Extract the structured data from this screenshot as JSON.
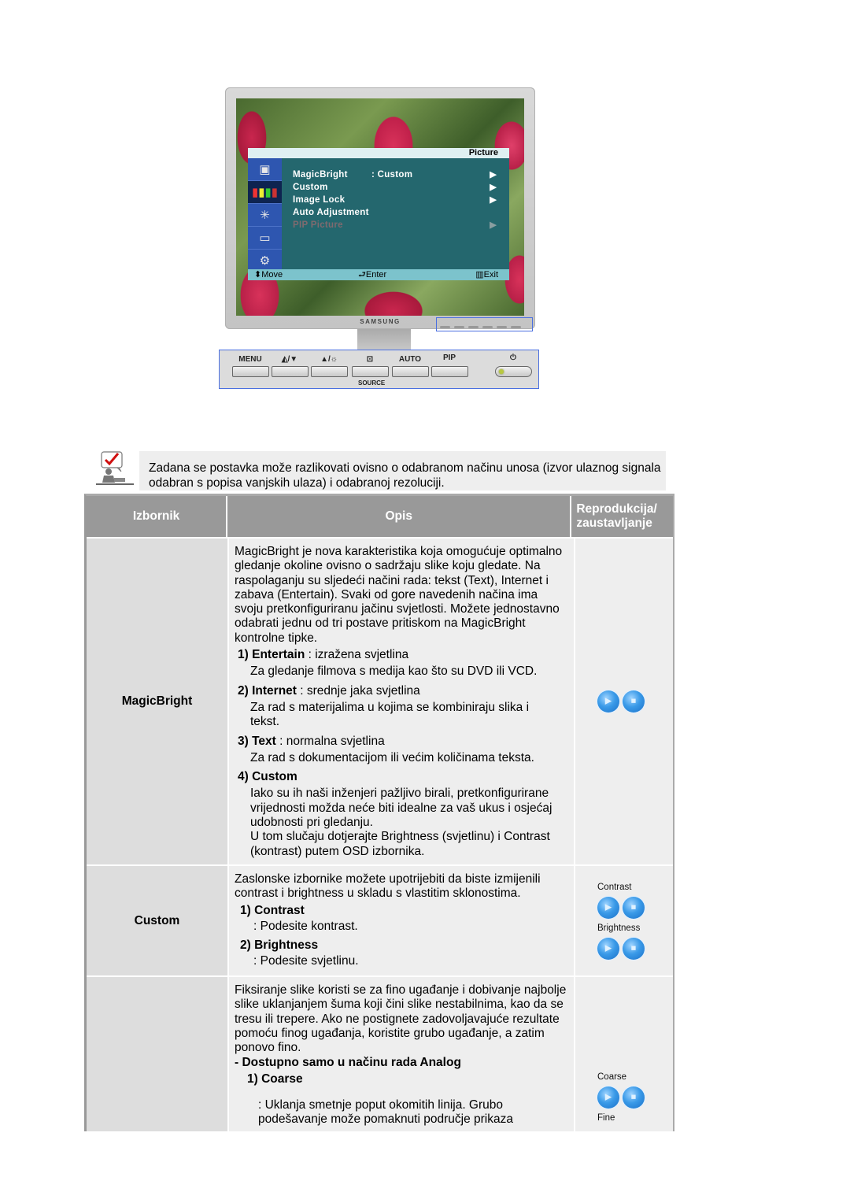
{
  "monitor": {
    "osd": {
      "title": "Picture",
      "side_icons": [
        "input-icon",
        "color-bars-icon",
        "magic-wand-icon",
        "pip-icon",
        "setup-sliders-icon"
      ],
      "items": [
        {
          "label": "MagicBright",
          "value": ": Custom",
          "arrow": "▶",
          "enabled": true
        },
        {
          "label": "Custom",
          "value": "",
          "arrow": "▶",
          "enabled": true
        },
        {
          "label": "Image Lock",
          "value": "",
          "arrow": "▶",
          "enabled": true
        },
        {
          "label": "Auto Adjustment",
          "value": "",
          "arrow": "",
          "enabled": true
        },
        {
          "label": "PIP Picture",
          "value": "",
          "arrow": "▶",
          "enabled": false
        }
      ],
      "footer": {
        "move": "⬍Move",
        "enter": "⮐Enter",
        "exit": "▥Exit"
      }
    },
    "brand": "SAMSUNG"
  },
  "control_panel": {
    "buttons": [
      {
        "label": "MENU",
        "icon": "menu-icon"
      },
      {
        "label": "◭/▼",
        "icon": "magicbright-down-icon"
      },
      {
        "label": "▲/☼",
        "icon": "up-brightness-icon"
      },
      {
        "label": "⊡",
        "icon": "source-icon"
      },
      {
        "label": "AUTO",
        "icon": ""
      },
      {
        "label": "PIP",
        "icon": ""
      }
    ],
    "source_label": "SOURCE",
    "power_glyph": "⏻"
  },
  "note": {
    "text": "Zadana se postavka može razlikovati ovisno o odabranom načinu unosa (izvor ulaznog signala odabran s popisa vanjskih ulaza) i odabranoj rezoluciji."
  },
  "table": {
    "headers": [
      "Izbornik",
      "Opis",
      "Reprodukcija/ zaustavljanje"
    ],
    "rows": [
      {
        "menu": "MagicBright",
        "intro": "MagicBright je nova karakteristika koja omogućuje optimalno gledanje okoline ovisno o sadržaju slike koju gledate. Na raspolaganju su sljedeći načini rada: tekst (Text), Internet i zabava (Entertain). Svaki od gore navedenih načina ima svoju pretkonfiguriranu jačinu svjetlosti. Možete jednostavno odabrati jednu od tri postave pritiskom na MagicBright kontrolne tipke.",
        "items": [
          {
            "num": "1)",
            "name": "Entertain",
            "suffix": " : izražena svjetlina",
            "desc": "Za gledanje filmova s medija kao što su DVD ili VCD."
          },
          {
            "num": "2)",
            "name": "Internet",
            "suffix": " : srednje jaka svjetlina",
            "desc": "Za rad s materijalima u kojima se kombiniraju slika i tekst."
          },
          {
            "num": "3)",
            "name": "Text",
            "suffix": " : normalna svjetlina",
            "desc": "Za rad s dokumentacijom ili većim količinama teksta."
          },
          {
            "num": "4)",
            "name": "Custom",
            "suffix": "",
            "desc": "Iako su ih naši inženjeri pažljivo birali, pretkonfigurirane vrijednosti možda neće biti idealne za vaš ukus i osjećaj udobnosti pri gledanju.",
            "desc2": "U tom slučaju dotjerajte Brightness (svjetlinu) i Contrast (kontrast) putem OSD izbornika."
          }
        ]
      },
      {
        "menu": "Custom",
        "intro": "Zaslonske izbornike možete upotrijebiti da biste izmijenili contrast i brightness u skladu s vlastitim sklonostima.",
        "items": [
          {
            "num": "1)",
            "name": "Contrast",
            "desc": ": Podesite kontrast."
          },
          {
            "num": "2)",
            "name": "Brightness",
            "desc": ": Podesite svjetlinu."
          }
        ],
        "media_labels": [
          "Contrast",
          "Brightness"
        ]
      },
      {
        "menu": "",
        "intro": "Fiksiranje slike koristi se za fino ugađanje i dobivanje najbolje slike uklanjanjem šuma koji čini slike nestabilnima, kao da se tresu ili trepere. Ako ne postignete zadovoljavajuće rezultate pomoću finog ugađanja, koristite grubo ugađanje, a zatim ponovo fino.",
        "note": "- Dostupno samo u načinu rada Analog",
        "items": [
          {
            "num": "1)",
            "name": "Coarse",
            "desc": ": Uklanja smetnje poput okomitih linija. Grubo podešavanje može pomaknuti područje prikaza"
          }
        ],
        "media_labels": [
          "Coarse",
          "Fine"
        ]
      }
    ],
    "media_buttons": {
      "play": "▶",
      "stop": "■"
    }
  }
}
